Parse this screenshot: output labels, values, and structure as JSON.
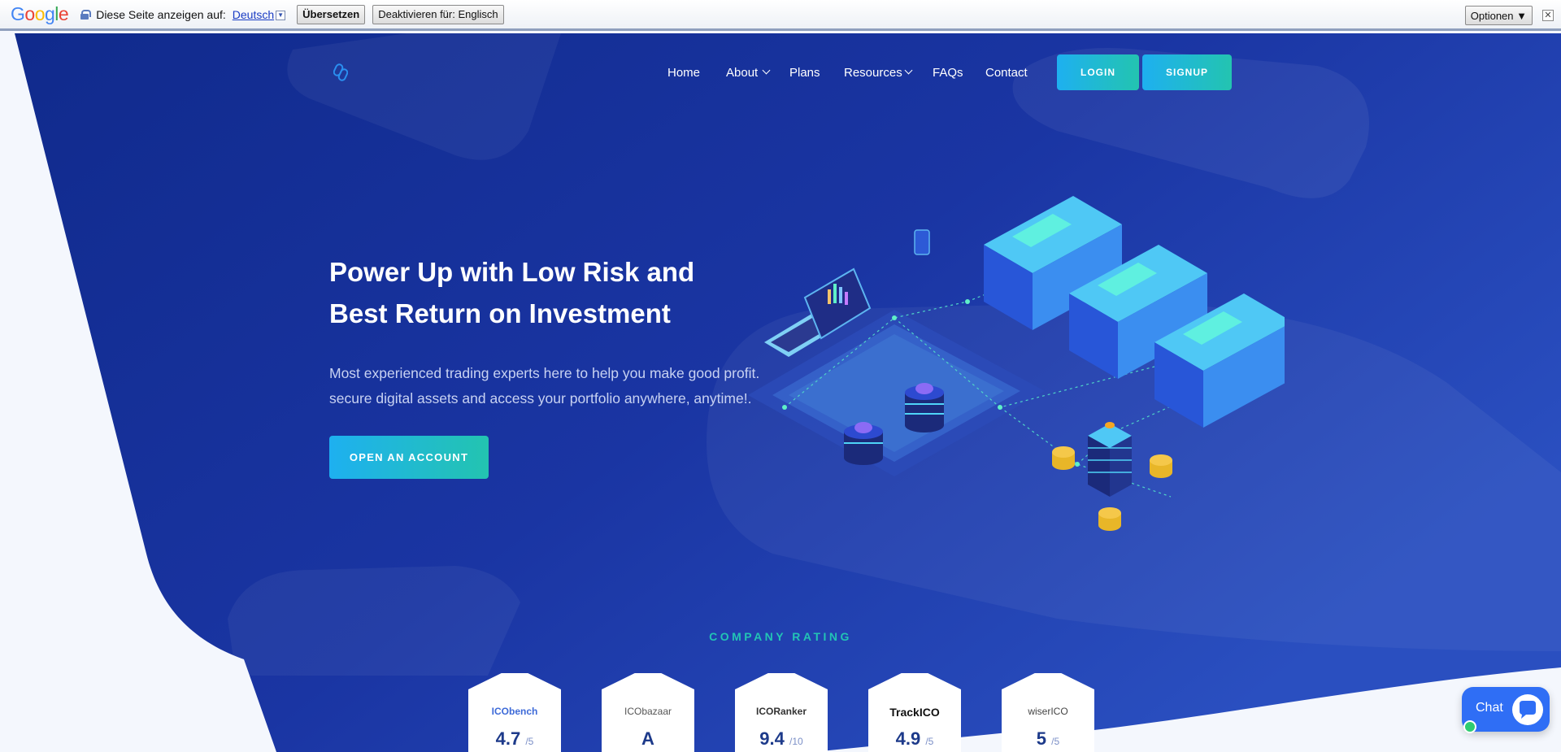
{
  "translate_bar": {
    "logo": "Google",
    "prompt": "Diese Seite anzeigen auf:",
    "language": "Deutsch",
    "translate_button": "Übersetzen",
    "disable_button": "Deaktivieren für: Englisch",
    "options_button": "Optionen ▼",
    "close": "✕"
  },
  "nav": {
    "items": [
      "Home",
      "About",
      "Plans",
      "Resources",
      "FAQs",
      "Contact"
    ],
    "login": "LOGIN",
    "signup": "SIGNUP"
  },
  "hero": {
    "title_line1": "Power Up with Low Risk and",
    "title_line2": "Best Return on Investment",
    "desc_line1": "Most experienced trading experts here to help you make good profit.",
    "desc_line2": "secure digital assets and access your portfolio anywhere, anytime!.",
    "cta": "OPEN AN ACCOUNT"
  },
  "ratings": {
    "label": "COMPANY RATING",
    "cards": [
      {
        "name": "ICObench",
        "score": "4.7",
        "denom": "/5"
      },
      {
        "name": "ICObazaar",
        "score": "A",
        "denom": ""
      },
      {
        "name": "ICORanker",
        "score": "9.4",
        "denom": "/10"
      },
      {
        "name": "TrackICO",
        "score": "4.9",
        "denom": "/5"
      },
      {
        "name": "wiserICO",
        "score": "5",
        "denom": "/5"
      }
    ]
  },
  "chat": {
    "label": "Chat"
  },
  "colors": {
    "primary": "#1a32a0",
    "accent": "#22c4b5",
    "button_start": "#1eb0f0",
    "button_end": "#23c4b0"
  }
}
